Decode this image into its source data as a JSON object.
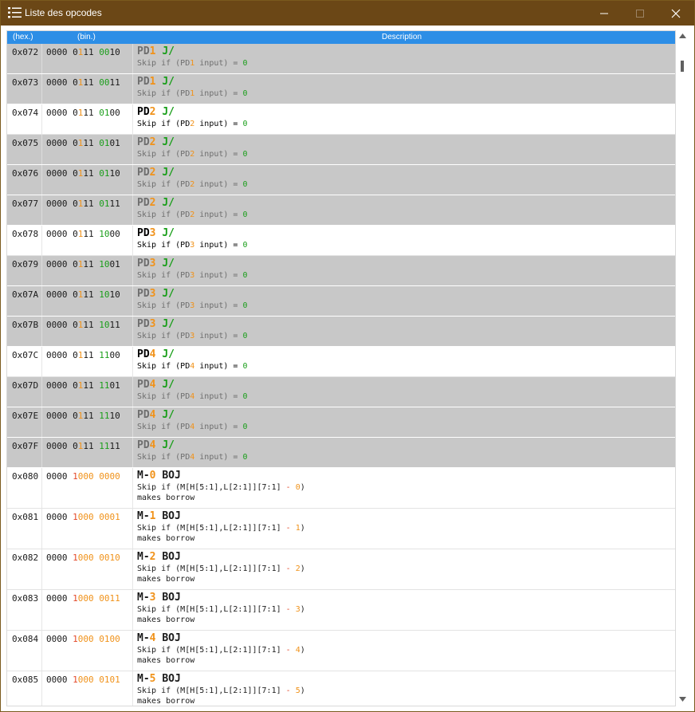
{
  "window": {
    "title": "Liste des opcodes",
    "app_icon": "list-icon"
  },
  "header": {
    "hex": "(hex.)",
    "bin": "(bin.)",
    "desc": "Description"
  },
  "rows": [
    {
      "hex": "0x072",
      "b1": "0000 0",
      "b2": "1",
      "b3": "11 ",
      "b4": "00",
      "b5": "10",
      "m1": "PD",
      "m2": "1",
      "m3": "J/",
      "d1": "Skip if (PD",
      "d2": "1",
      "d3": " input) = ",
      "d4": "0",
      "style": "dim"
    },
    {
      "hex": "0x073",
      "b1": "0000 0",
      "b2": "1",
      "b3": "11 ",
      "b4": "00",
      "b5": "11",
      "m1": "PD",
      "m2": "1",
      "m3": "J/",
      "d1": "Skip if (PD",
      "d2": "1",
      "d3": " input) = ",
      "d4": "0",
      "style": "dim"
    },
    {
      "hex": "0x074",
      "b1": "0000 0",
      "b2": "1",
      "b3": "11 ",
      "b4": "01",
      "b5": "00",
      "m1": "PD",
      "m2": "2",
      "m3": "J/",
      "d1": "Skip if (PD",
      "d2": "2",
      "d3": " input) = ",
      "d4": "0",
      "style": "lit"
    },
    {
      "hex": "0x075",
      "b1": "0000 0",
      "b2": "1",
      "b3": "11 ",
      "b4": "01",
      "b5": "01",
      "m1": "PD",
      "m2": "2",
      "m3": "J/",
      "d1": "Skip if (PD",
      "d2": "2",
      "d3": " input) = ",
      "d4": "0",
      "style": "dim"
    },
    {
      "hex": "0x076",
      "b1": "0000 0",
      "b2": "1",
      "b3": "11 ",
      "b4": "01",
      "b5": "10",
      "m1": "PD",
      "m2": "2",
      "m3": "J/",
      "d1": "Skip if (PD",
      "d2": "2",
      "d3": " input) = ",
      "d4": "0",
      "style": "dim"
    },
    {
      "hex": "0x077",
      "b1": "0000 0",
      "b2": "1",
      "b3": "11 ",
      "b4": "01",
      "b5": "11",
      "m1": "PD",
      "m2": "2",
      "m3": "J/",
      "d1": "Skip if (PD",
      "d2": "2",
      "d3": " input) = ",
      "d4": "0",
      "style": "dim"
    },
    {
      "hex": "0x078",
      "b1": "0000 0",
      "b2": "1",
      "b3": "11 ",
      "b4": "10",
      "b5": "00",
      "m1": "PD",
      "m2": "3",
      "m3": "J/",
      "d1": "Skip if (PD",
      "d2": "3",
      "d3": " input) = ",
      "d4": "0",
      "style": "lit"
    },
    {
      "hex": "0x079",
      "b1": "0000 0",
      "b2": "1",
      "b3": "11 ",
      "b4": "10",
      "b5": "01",
      "m1": "PD",
      "m2": "3",
      "m3": "J/",
      "d1": "Skip if (PD",
      "d2": "3",
      "d3": " input) = ",
      "d4": "0",
      "style": "dim"
    },
    {
      "hex": "0x07A",
      "b1": "0000 0",
      "b2": "1",
      "b3": "11 ",
      "b4": "10",
      "b5": "10",
      "m1": "PD",
      "m2": "3",
      "m3": "J/",
      "d1": "Skip if (PD",
      "d2": "3",
      "d3": " input) = ",
      "d4": "0",
      "style": "dim"
    },
    {
      "hex": "0x07B",
      "b1": "0000 0",
      "b2": "1",
      "b3": "11 ",
      "b4": "10",
      "b5": "11",
      "m1": "PD",
      "m2": "3",
      "m3": "J/",
      "d1": "Skip if (PD",
      "d2": "3",
      "d3": " input) = ",
      "d4": "0",
      "style": "dim"
    },
    {
      "hex": "0x07C",
      "b1": "0000 0",
      "b2": "1",
      "b3": "11 ",
      "b4": "11",
      "b5": "00",
      "m1": "PD",
      "m2": "4",
      "m3": "J/",
      "d1": "Skip if (PD",
      "d2": "4",
      "d3": " input) = ",
      "d4": "0",
      "style": "lit"
    },
    {
      "hex": "0x07D",
      "b1": "0000 0",
      "b2": "1",
      "b3": "11 ",
      "b4": "11",
      "b5": "01",
      "m1": "PD",
      "m2": "4",
      "m3": "J/",
      "d1": "Skip if (PD",
      "d2": "4",
      "d3": " input) = ",
      "d4": "0",
      "style": "dim"
    },
    {
      "hex": "0x07E",
      "b1": "0000 0",
      "b2": "1",
      "b3": "11 ",
      "b4": "11",
      "b5": "10",
      "m1": "PD",
      "m2": "4",
      "m3": "J/",
      "d1": "Skip if (PD",
      "d2": "4",
      "d3": " input) = ",
      "d4": "0",
      "style": "dim"
    },
    {
      "hex": "0x07F",
      "b1": "0000 0",
      "b2": "1",
      "b3": "11 ",
      "b4": "11",
      "b5": "11",
      "m1": "PD",
      "m2": "4",
      "m3": "J/",
      "d1": "Skip if (PD",
      "d2": "4",
      "d3": " input) = ",
      "d4": "0",
      "style": "dim"
    }
  ],
  "mrows": [
    {
      "hex": "0x080",
      "b1": "0000 ",
      "b2": "1",
      "b3": "000 0000",
      "m1": "M-",
      "m2": "0",
      "m3": "BOJ",
      "d1": "Skip if (M[H[5:1],L[2:1]][7:1] ",
      "d2": "-",
      "d3": " ",
      "d4": "0",
      "d5": ")",
      "d6": "makes borrow"
    },
    {
      "hex": "0x081",
      "b1": "0000 ",
      "b2": "1",
      "b3": "000 0001",
      "m1": "M-",
      "m2": "1",
      "m3": "BOJ",
      "d1": "Skip if (M[H[5:1],L[2:1]][7:1] ",
      "d2": "-",
      "d3": " ",
      "d4": "1",
      "d5": ")",
      "d6": "makes borrow"
    },
    {
      "hex": "0x082",
      "b1": "0000 ",
      "b2": "1",
      "b3": "000 0010",
      "m1": "M-",
      "m2": "2",
      "m3": "BOJ",
      "d1": "Skip if (M[H[5:1],L[2:1]][7:1] ",
      "d2": "-",
      "d3": " ",
      "d4": "2",
      "d5": ")",
      "d6": "makes borrow"
    },
    {
      "hex": "0x083",
      "b1": "0000 ",
      "b2": "1",
      "b3": "000 0011",
      "m1": "M-",
      "m2": "3",
      "m3": "BOJ",
      "d1": "Skip if (M[H[5:1],L[2:1]][7:1] ",
      "d2": "-",
      "d3": " ",
      "d4": "3",
      "d5": ")",
      "d6": "makes borrow"
    },
    {
      "hex": "0x084",
      "b1": "0000 ",
      "b2": "1",
      "b3": "000 0100",
      "m1": "M-",
      "m2": "4",
      "m3": "BOJ",
      "d1": "Skip if (M[H[5:1],L[2:1]][7:1] ",
      "d2": "-",
      "d3": " ",
      "d4": "4",
      "d5": ")",
      "d6": "makes borrow"
    },
    {
      "hex": "0x085",
      "b1": "0000 ",
      "b2": "1",
      "b3": "000 0101",
      "m1": "M-",
      "m2": "5",
      "m3": "BOJ",
      "d1": "Skip if (M[H[5:1],L[2:1]][7:1] ",
      "d2": "-",
      "d3": " ",
      "d4": "5",
      "d5": ")",
      "d6": "makes borrow"
    }
  ],
  "scrollbar": {
    "up_icon": "chevron-up-icon",
    "down_icon": "chevron-down-icon"
  }
}
